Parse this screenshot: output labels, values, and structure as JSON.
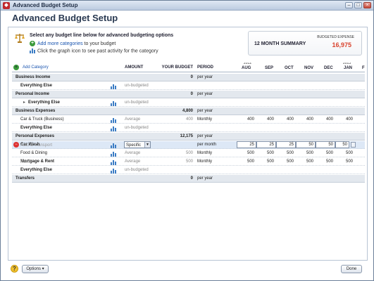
{
  "window": {
    "title": "Advanced Budget Setup",
    "heading": "Advanced Budget Setup"
  },
  "instructions": {
    "main": "Select any budget line below for advanced budgeting options",
    "add_link": "Add more categories",
    "add_rest": " to your budget",
    "graph": "Click the graph icon to see past activity for the category"
  },
  "summary": {
    "label": "12 MONTH SUMMARY",
    "expense_label": "BUDGETED EXPENSE",
    "expense_value": "16,975"
  },
  "columns": {
    "add_category": "Add Category",
    "amount": "AMOUNT",
    "your_budget": "YOUR BUDGET",
    "period": "PERIOD",
    "year_2012": "2012",
    "year_2013": "2013",
    "months": [
      "AUG",
      "SEP",
      "OCT",
      "NOV",
      "DEC",
      "JAN",
      "FE"
    ]
  },
  "rows": [
    {
      "name": "Business Income",
      "budget": "0",
      "period": "per year"
    },
    {
      "name": "Everything Else",
      "amount": "un-budgeted"
    },
    {
      "name": "Personal Income",
      "budget": "0",
      "period": "per year"
    },
    {
      "name": "Everything Else",
      "amount": "un-budgeted"
    },
    {
      "name": "Business Expenses",
      "budget": "4,800",
      "period": "per year"
    },
    {
      "name": "Car & Truck (Business)",
      "amount": "Average",
      "budget": "400",
      "period": "Monthly",
      "months": [
        "400",
        "400",
        "400",
        "400",
        "400",
        "400"
      ]
    },
    {
      "name": "Everything Else",
      "amount": "un-budgeted"
    },
    {
      "name": "Personal Expenses",
      "budget": "12,175",
      "period": "per year"
    },
    {
      "parent": "Auto & Transport",
      "name": "Car Wash",
      "amount": "Specific",
      "period": "per month",
      "months": [
        "25",
        "25",
        "25",
        "50",
        "50",
        "50"
      ]
    },
    {
      "name": "Food & Dining",
      "amount": "Average",
      "budget": "500",
      "period": "Monthly",
      "months": [
        "500",
        "500",
        "500",
        "500",
        "500",
        "500"
      ]
    },
    {
      "parent": "Home",
      "name": "Mortgage & Rent",
      "amount": "Average",
      "budget": "500",
      "period": "Monthly",
      "months": [
        "500",
        "500",
        "500",
        "500",
        "500",
        "500"
      ]
    },
    {
      "name": "Everything Else",
      "amount": "un-budgeted"
    },
    {
      "name": "Transfers",
      "budget": "0",
      "period": "per year"
    }
  ],
  "footer": {
    "options": "Options",
    "done": "Done"
  }
}
